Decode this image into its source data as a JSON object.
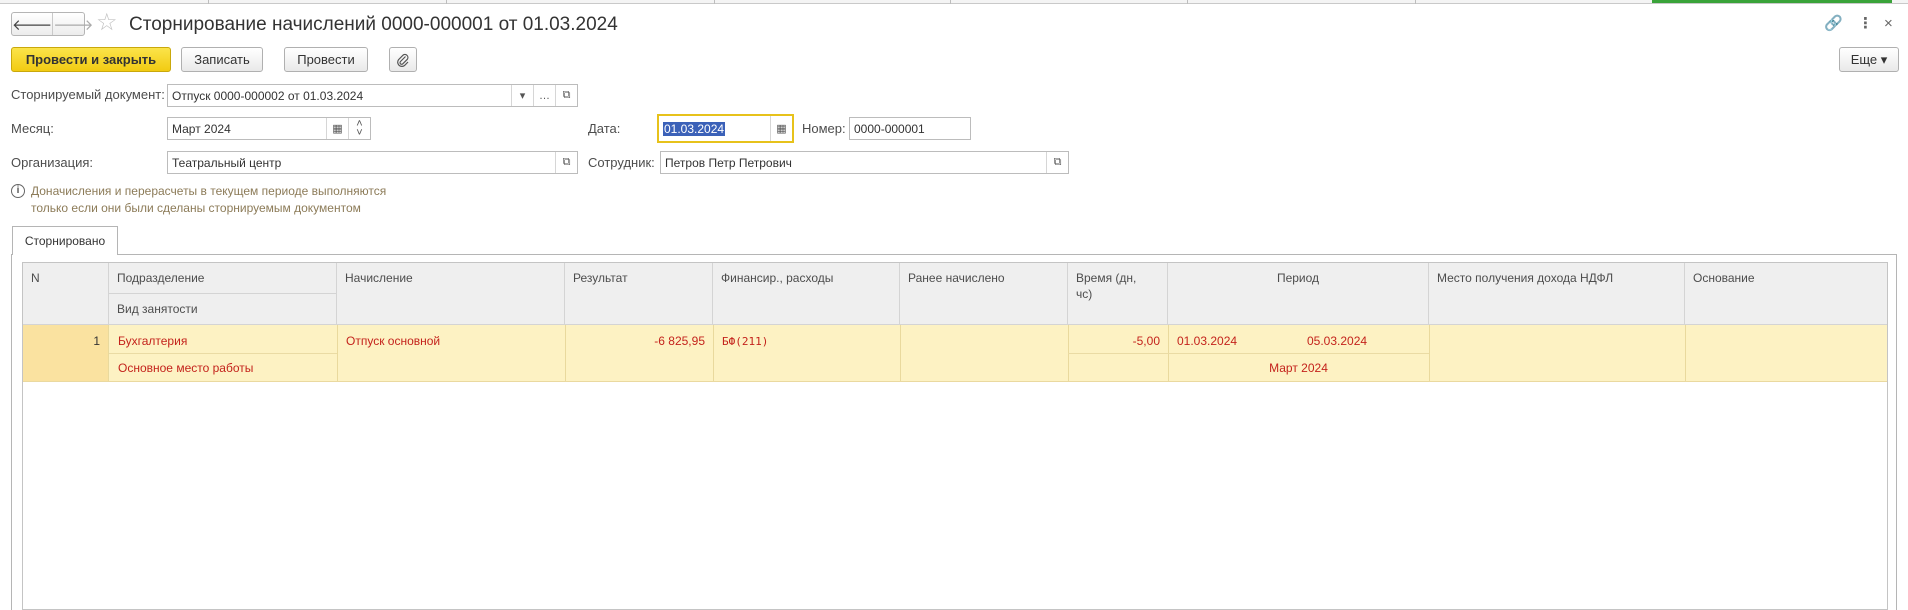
{
  "window": {
    "title": "Сторнирование начислений 0000-000001 от 01.03.2024",
    "more_icon": "more-vertical-icon",
    "link_icon": "link-icon",
    "close_icon": "close-icon",
    "star_icon": "star-icon"
  },
  "toolbar": {
    "post_close": "Провести и закрыть",
    "save": "Записать",
    "post": "Провести",
    "attach_icon": "paperclip-icon",
    "more": "Еще ▾"
  },
  "form": {
    "storno_doc": {
      "label": "Сторнируемый документ:",
      "value": "Отпуск 0000-000002 от 01.03.2024"
    },
    "month": {
      "label": "Месяц:",
      "value": "Март 2024"
    },
    "date": {
      "label": "Дата:",
      "value": "01.03.2024"
    },
    "number": {
      "label": "Номер:",
      "value": "0000-000001"
    },
    "org": {
      "label": "Организация:",
      "value": "Театральный центр"
    },
    "employee": {
      "label": "Сотрудник:",
      "value": "Петров Петр Петрович"
    },
    "info_line1": "Доначисления и перерасчеты в текущем периоде выполняются",
    "info_line2": "только если они были сделаны сторнируемым документом"
  },
  "tabs": {
    "active": "Сторнировано"
  },
  "table": {
    "headers": {
      "n": "N",
      "dept": "Подразделение",
      "employment": "Вид занятости",
      "accrual": "Начисление",
      "result": "Результат",
      "finance": "Финансир., расходы",
      "prev": "Ранее начислено",
      "time": "Время (дн,\nчс)",
      "period": "Период",
      "ndfl": "Место получения дохода НДФЛ",
      "basis": "Основание"
    },
    "row": {
      "n": "1",
      "dept": "Бухгалтерия",
      "employment": "Основное место работы",
      "accrual": "Отпуск основной",
      "result": "-6 825,95",
      "finance": "БФ(211)",
      "time": "-5,00",
      "period_from": "01.03.2024",
      "period_to": "05.03.2024",
      "period_month": "Март 2024"
    }
  }
}
